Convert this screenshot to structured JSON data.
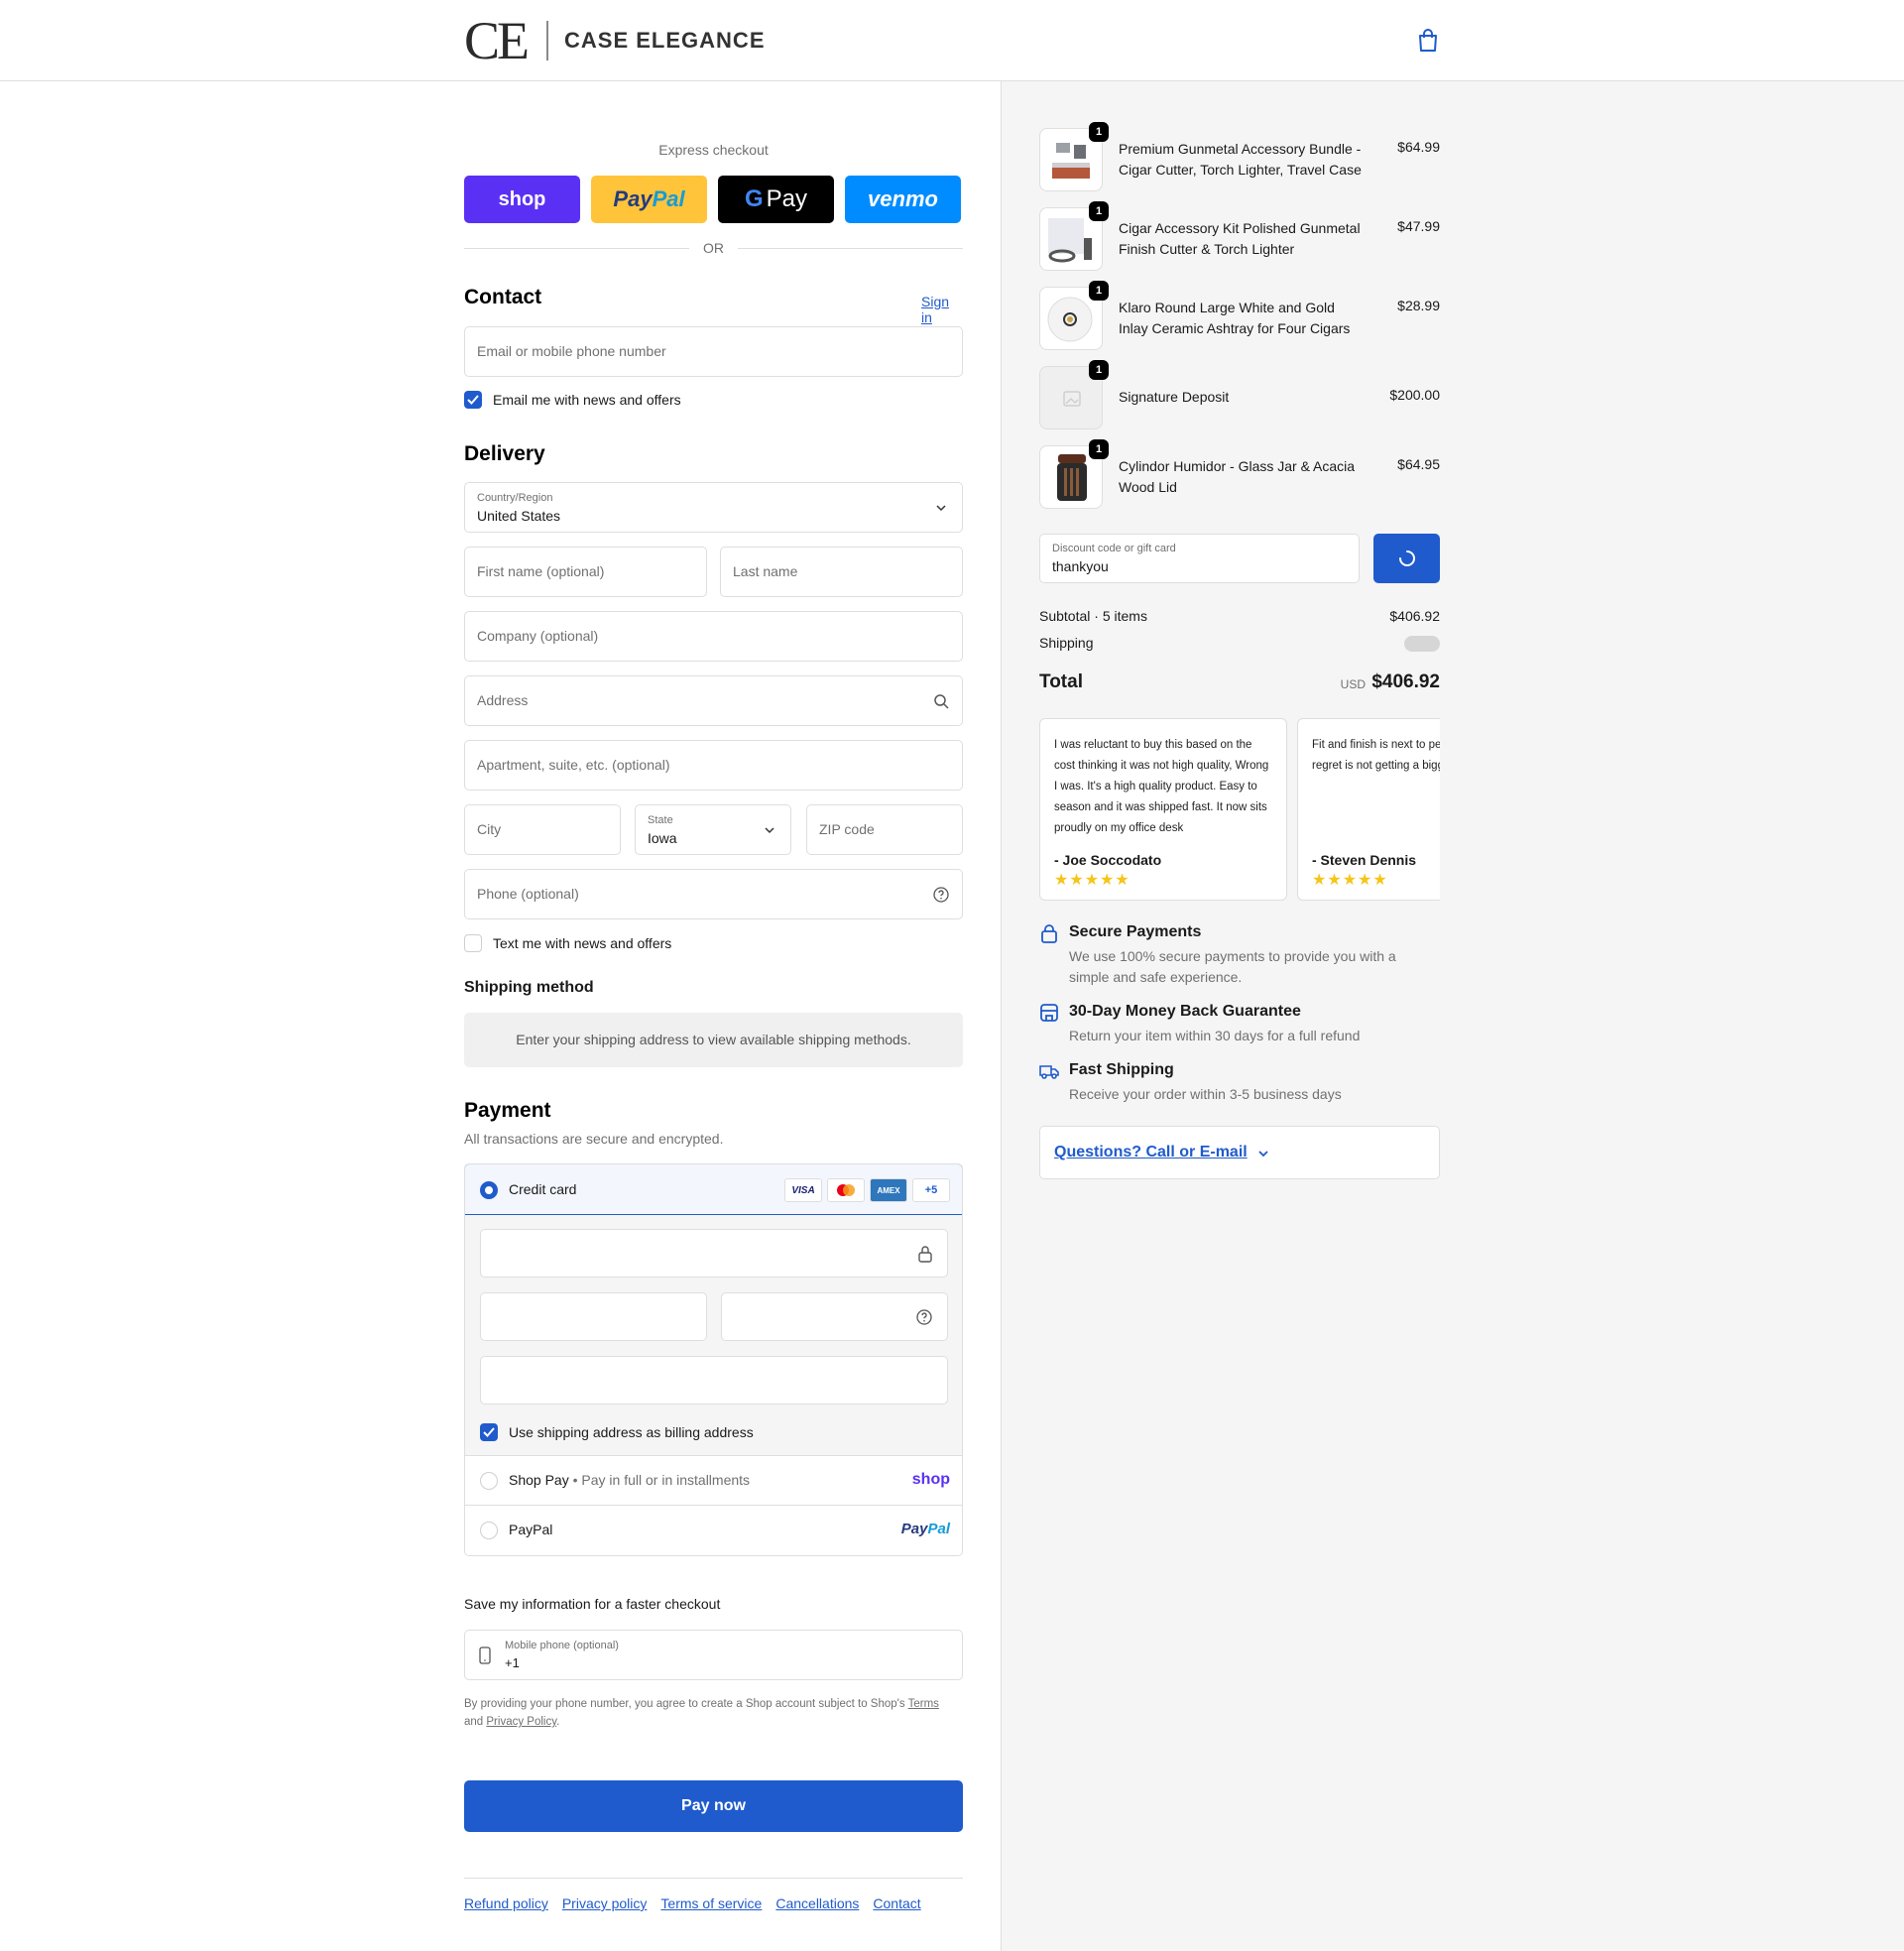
{
  "brand": {
    "mark": "CE",
    "name": "CASE ELEGANCE"
  },
  "express": {
    "title": "Express checkout",
    "buttons": {
      "shop": "shop",
      "paypal_a": "Pay",
      "paypal_b": "Pal",
      "gpay_g": "G",
      "gpay_text": "Pay",
      "venmo": "venmo"
    },
    "or": "OR"
  },
  "contact": {
    "title": "Contact",
    "sign_in": "Sign in",
    "email_placeholder": "Email or mobile phone number",
    "news_label": "Email me with news and offers",
    "news_checked": true
  },
  "delivery": {
    "title": "Delivery",
    "country_label": "Country/Region",
    "country_value": "United States",
    "first_name": "First name (optional)",
    "last_name": "Last name",
    "company": "Company (optional)",
    "address": "Address",
    "apartment": "Apartment, suite, etc. (optional)",
    "city": "City",
    "state_label": "State",
    "state_value": "Iowa",
    "zip": "ZIP code",
    "phone": "Phone (optional)",
    "text_label": "Text me with news and offers",
    "text_checked": false
  },
  "shipping_method": {
    "title": "Shipping method",
    "message": "Enter your shipping address to view available shipping methods."
  },
  "payment": {
    "title": "Payment",
    "subtitle": "All transactions are secure and encrypted.",
    "credit_card": "Credit card",
    "cards": {
      "visa": "VISA",
      "amex": "AMEX",
      "more": "+5"
    },
    "billing_label": "Use shipping address as billing address",
    "billing_checked": true,
    "shop_pay": "Shop Pay",
    "shop_pay_sub": "Pay in full or in installments",
    "shop_pay_logo": "shop",
    "paypal": "PayPal",
    "paypal_logo_a": "Pay",
    "paypal_logo_b": "Pal"
  },
  "save_info": {
    "title": "Save my information for a faster checkout",
    "mobile_label": "Mobile phone (optional)",
    "mobile_value": "+1",
    "legal_a": "By providing your phone number, you agree to create a Shop account subject to Shop's ",
    "terms": "Terms",
    "legal_b": "and ",
    "privacy": "Privacy Policy",
    "legal_c": "."
  },
  "pay_now": "Pay now",
  "footer": {
    "links": [
      "Refund policy",
      "Privacy policy",
      "Terms of service",
      "Cancellations",
      "Contact"
    ]
  },
  "order": {
    "items": [
      {
        "name": "Premium Gunmetal Accessory Bundle - Cigar Cutter, Torch Lighter, Travel Case",
        "price": "$64.99",
        "qty": "1"
      },
      {
        "name": "Cigar Accessory Kit Polished Gunmetal Finish Cutter & Torch Lighter",
        "price": "$47.99",
        "qty": "1"
      },
      {
        "name": "Klaro Round Large White and Gold Inlay Ceramic Ashtray for Four Cigars",
        "price": "$28.99",
        "qty": "1"
      },
      {
        "name": "Signature Deposit",
        "price": "$200.00",
        "qty": "1"
      },
      {
        "name": "Cylindor Humidor - Glass Jar & Acacia Wood Lid",
        "price": "$64.95",
        "qty": "1"
      }
    ],
    "discount_label": "Discount code or gift card",
    "discount_value": "thankyou",
    "subtotal_label": "Subtotal · 5 items",
    "subtotal": "$406.92",
    "shipping_label": "Shipping",
    "total_label": "Total",
    "currency": "USD",
    "total": "$406.92"
  },
  "reviews": [
    {
      "text": "I was reluctant to buy this based on the cost thinking it was not high quality, Wrong I was. It's a high quality product. Easy to season and it was shipped fast. It now sits proudly on my office desk",
      "author": "- Joe Soccodato",
      "stars": "★★★★★"
    },
    {
      "text": "Fit and finish is next to perfect. My only regret is not getting a bigger one.",
      "author": "- Steven Dennis",
      "stars": "★★★★★"
    }
  ],
  "features": [
    {
      "title": "Secure Payments",
      "desc": "We use 100% secure payments to provide you with a simple and safe experience."
    },
    {
      "title": "30-Day Money Back Guarantee",
      "desc": "Return your item within 30 days for a full refund"
    },
    {
      "title": "Fast Shipping",
      "desc": "Receive your order within 3-5 business days"
    }
  ],
  "questions": "Questions? Call or E-mail",
  "colors": {
    "accent": "#1f5bcc",
    "shop": "#5a31f4",
    "paypal": "#ffc439",
    "venmo": "#008cff"
  }
}
